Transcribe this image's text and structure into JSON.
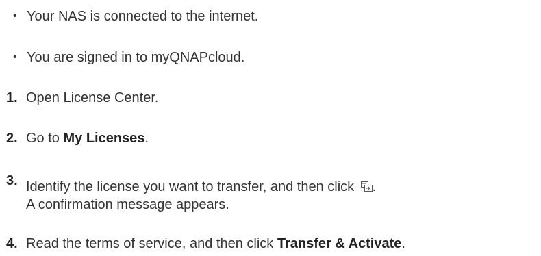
{
  "prerequisites": [
    "Your NAS is connected to the internet.",
    "You are signed in to myQNAPcloud."
  ],
  "steps": [
    {
      "number": "1.",
      "text": "Open License Center."
    },
    {
      "number": "2.",
      "before": "Go to ",
      "bold": "My Licenses",
      "after": "."
    },
    {
      "number": "3.",
      "before": "Identify the license you want to transfer, and then click ",
      "icon": "transfer-license-icon",
      "after": ".",
      "line2": "A confirmation message appears."
    },
    {
      "number": "4.",
      "before": "Read the terms of service, and then click ",
      "bold": "Transfer & Activate",
      "after": "."
    }
  ]
}
